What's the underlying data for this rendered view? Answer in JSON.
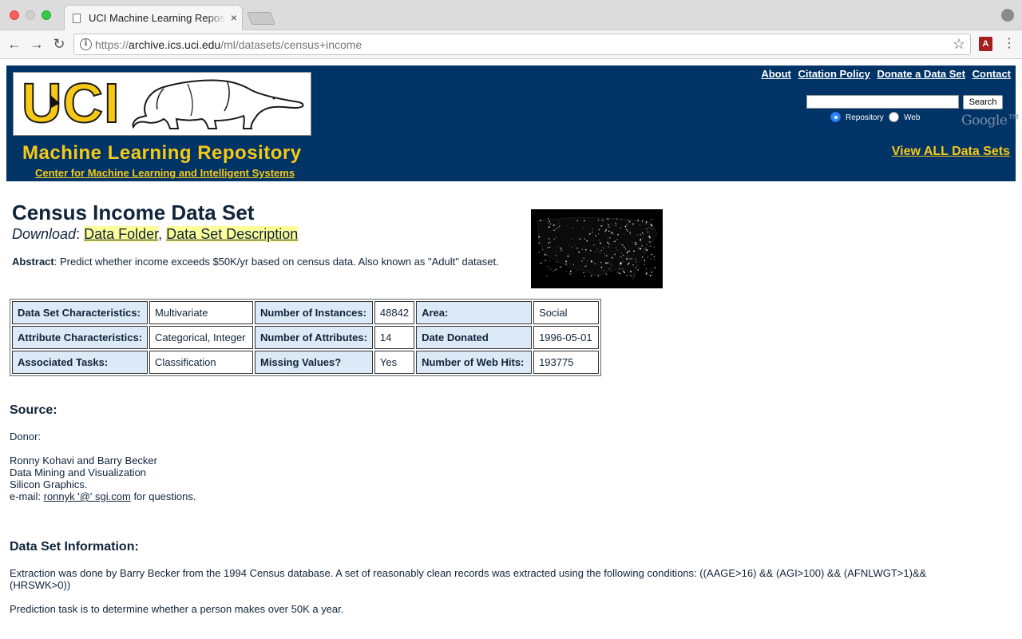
{
  "browser": {
    "tab_title": "UCI Machine Learning Repository",
    "tab_close": "×",
    "url_prefix": "https://",
    "url_host": "archive.ics.uci.edu",
    "url_path": "/ml/datasets/census+income",
    "back_glyph": "←",
    "forward_glyph": "→",
    "reload_glyph": "↻",
    "star_glyph": "☆",
    "menu_glyph": "⋮",
    "pdf_glyph": "A",
    "info_glyph": "i"
  },
  "header": {
    "logo_text": "UCI",
    "repo_title": "Machine Learning Repository",
    "center_link": "Center for Machine Learning and Intelligent Systems",
    "top_links": [
      "About",
      "Citation Policy",
      "Donate a Data Set",
      "Contact"
    ],
    "search_button": "Search",
    "radio_repository": "Repository",
    "radio_web": "Web",
    "google_label": "Google™",
    "view_all": "View ALL Data Sets",
    "accent_color": "#f7c916",
    "banner_color": "#003366"
  },
  "dataset": {
    "title": "Census Income Data Set",
    "download_label": "Download",
    "download_sep": ":",
    "download_links": [
      "Data Folder",
      "Data Set Description"
    ],
    "abstract_label": "Abstract",
    "abstract_text": ": Predict whether income exceeds $50K/yr based on census data. Also known as \"Adult\" dataset.",
    "table": [
      [
        "Data Set Characteristics:",
        "Multivariate",
        "Number of Instances:",
        "48842",
        "Area:",
        "Social"
      ],
      [
        "Attribute Characteristics:",
        "Categorical, Integer",
        "Number of Attributes:",
        "14",
        "Date Donated",
        "1996-05-01"
      ],
      [
        "Associated Tasks:",
        "Classification",
        "Missing Values?",
        "Yes",
        "Number of Web Hits:",
        "193775"
      ]
    ]
  },
  "source": {
    "heading": "Source:",
    "donor_label": "Donor:",
    "lines": [
      "Ronny Kohavi and Barry Becker",
      "Data Mining and Visualization",
      "Silicon Graphics."
    ],
    "email_prefix": "e-mail: ",
    "email_link": "ronnyk '@' sgi.com",
    "email_suffix": " for questions."
  },
  "info": {
    "heading": "Data Set Information:",
    "para1_line1": "Extraction was done by Barry Becker from the 1994 Census database. A set of reasonably clean records was extracted using the following conditions: ((AAGE>16) && (AGI>100) && (AFNLWGT>1)&&",
    "para1_line2": "(HRSWK>0))",
    "para2": "Prediction task is to determine whether a person makes over 50K a year."
  }
}
